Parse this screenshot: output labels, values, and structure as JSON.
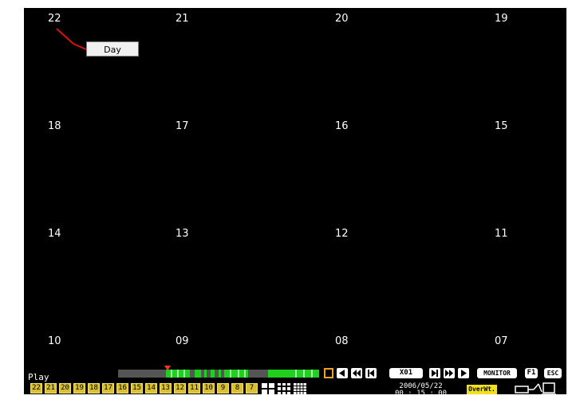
{
  "calendar": {
    "days": [
      "22",
      "21",
      "20",
      "19",
      "18",
      "17",
      "16",
      "15",
      "14",
      "13",
      "12",
      "11",
      "10",
      "09",
      "08",
      "07"
    ]
  },
  "tooltip": {
    "label": "Day"
  },
  "control_bar": {
    "mode_label": "Play",
    "speed_label": "X01",
    "monitor_label": "MONITOR",
    "f1_label": "F1",
    "esc_label": "ESC",
    "date": "2006/05/22",
    "time": "00 : 15 : 00",
    "overwrite_label": "OverWt.",
    "day_buttons": [
      "22",
      "21",
      "20",
      "19",
      "18",
      "17",
      "16",
      "15",
      "14",
      "13",
      "12",
      "11",
      "10",
      "9",
      "8",
      "7"
    ]
  },
  "colors": {
    "background": "#000000",
    "timeline_recorded": "#1fd01f",
    "timeline_empty": "#555555",
    "marker": "#ff3030",
    "day_button": "#d8c030",
    "overwrite_badge": "#f0e020",
    "stop_button_border": "#f4a020"
  }
}
